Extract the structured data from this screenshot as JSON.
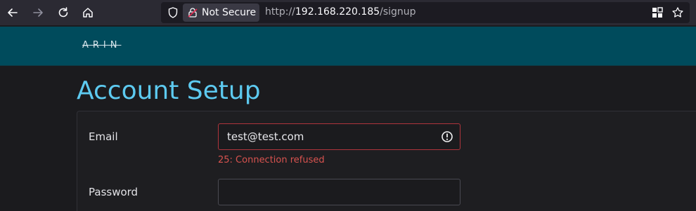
{
  "browser": {
    "security_label": "Not Secure",
    "url_scheme": "http://",
    "url_host": "192.168.220.185",
    "url_path": "/signup"
  },
  "site": {
    "logo_text": "ARIN"
  },
  "page": {
    "title": "Account Setup"
  },
  "form": {
    "email_label": "Email",
    "email_value": "test@test.com",
    "email_error": "25: Connection refused",
    "password_label": "Password",
    "password_value": ""
  },
  "colors": {
    "toolbar": "#2b2a33",
    "header": "#004b5c",
    "title": "#5dcaf0",
    "error": "#d9534f"
  }
}
